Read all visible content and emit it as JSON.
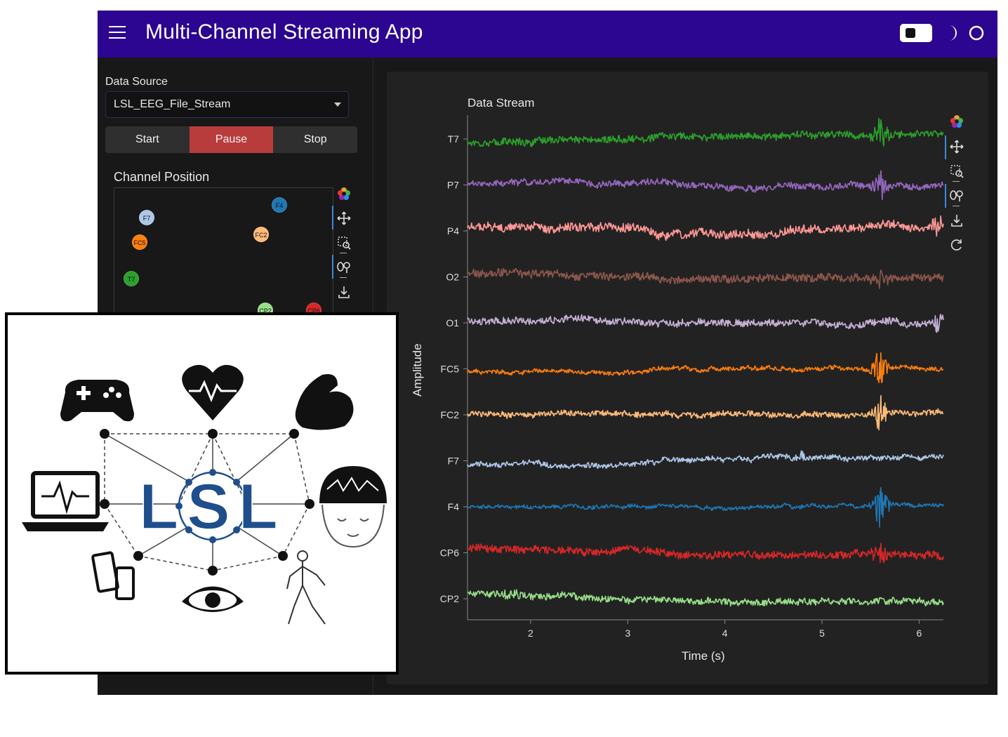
{
  "header": {
    "title": "Multi-Channel Streaming App",
    "menu_icon": "hamburger-menu-icon",
    "theme_toggle_icon": "toggle-switch-icon",
    "dark_mode_icon": "moon-icon",
    "light_mode_icon": "circle-icon",
    "bg_color": "#2c0591"
  },
  "sidebar": {
    "data_source_label": "Data Source",
    "data_source_value": "LSL_EEG_File_Stream",
    "buttons": {
      "start": "Start",
      "pause": "Pause",
      "stop": "Stop"
    },
    "active_button": "Pause",
    "channel_position": {
      "title": "Channel Position",
      "channels": [
        {
          "label": "F7",
          "color": "#aec7e8"
        },
        {
          "label": "F4",
          "color": "#1f77b4"
        },
        {
          "label": "FC2",
          "color": "#ffbb78"
        },
        {
          "label": "FC5",
          "color": "#ff7f0e"
        },
        {
          "label": "T7",
          "color": "#2ca02c"
        },
        {
          "label": "CP2",
          "color": "#98df8a"
        },
        {
          "label": "CP6",
          "color": "#d62728"
        }
      ]
    },
    "toolbar_icons": [
      "bokeh-logo-icon",
      "pan-icon",
      "box-zoom-icon",
      "wheel-zoom-icon",
      "save-icon"
    ]
  },
  "main": {
    "toolbar_icons": [
      "bokeh-logo-icon",
      "pan-icon",
      "box-zoom-icon",
      "wheel-zoom-icon",
      "save-icon",
      "reset-icon"
    ]
  },
  "chart_data": {
    "type": "line",
    "title": "Data Stream",
    "xlabel": "Time (s)",
    "ylabel": "Amplitude",
    "xlim": [
      1.35,
      6.25
    ],
    "x_ticks": [
      2,
      3,
      4,
      5,
      6
    ],
    "categories": [
      "T7",
      "P7",
      "P4",
      "O2",
      "O1",
      "FC5",
      "FC2",
      "F7",
      "F4",
      "CP6",
      "CP2"
    ],
    "grid": false,
    "series": [
      {
        "name": "T7",
        "color": "#2ca02c",
        "noise": 0.32,
        "trend": [
          [
            1.35,
            -0.3
          ],
          [
            3.0,
            -0.1
          ],
          [
            3.3,
            0.25
          ],
          [
            6.25,
            0.45
          ]
        ],
        "bursts": [
          [
            5.6,
            1.6
          ]
        ]
      },
      {
        "name": "P7",
        "color": "#9467bd",
        "noise": 0.3,
        "trend": [
          [
            1.35,
            0.2
          ],
          [
            2.5,
            0.3
          ],
          [
            3.5,
            0.1
          ],
          [
            4.2,
            -0.2
          ],
          [
            5.5,
            -0.1
          ],
          [
            6.25,
            0.1
          ]
        ],
        "bursts": [
          [
            5.6,
            1.4
          ]
        ]
      },
      {
        "name": "P4",
        "color": "#ff9896",
        "noise": 0.4,
        "trend": [
          [
            1.35,
            0.4
          ],
          [
            3.2,
            0.2
          ],
          [
            3.3,
            -0.4
          ],
          [
            4.5,
            -0.2
          ],
          [
            5.0,
            0.3
          ],
          [
            6.25,
            0.4
          ]
        ],
        "bursts": [
          [
            6.2,
            1.2
          ]
        ]
      },
      {
        "name": "O2",
        "color": "#8c564b",
        "noise": 0.35,
        "trend": [
          [
            1.35,
            0.3
          ],
          [
            3.2,
            0.2
          ],
          [
            3.3,
            -0.1
          ],
          [
            6.25,
            -0.1
          ]
        ],
        "bursts": [
          [
            5.6,
            1.0
          ]
        ]
      },
      {
        "name": "O1",
        "color": "#c5b0d5",
        "noise": 0.32,
        "trend": [
          [
            1.35,
            0.2
          ],
          [
            2.5,
            0.45
          ],
          [
            3.2,
            0.1
          ],
          [
            3.4,
            -0.1
          ],
          [
            6.25,
            0.0
          ]
        ],
        "bursts": [
          [
            6.2,
            1.0
          ]
        ]
      },
      {
        "name": "FC5",
        "color": "#ff7f0e",
        "noise": 0.18,
        "trend": [
          [
            1.35,
            -0.3
          ],
          [
            3.2,
            -0.2
          ],
          [
            3.3,
            0.05
          ],
          [
            6.25,
            0.05
          ]
        ],
        "bursts": [
          [
            5.6,
            2.0
          ]
        ]
      },
      {
        "name": "FC2",
        "color": "#ffbb78",
        "noise": 0.26,
        "trend": [
          [
            1.35,
            0.1
          ],
          [
            4.0,
            0.0
          ],
          [
            6.25,
            0.1
          ]
        ],
        "bursts": [
          [
            5.6,
            1.8
          ]
        ]
      },
      {
        "name": "F7",
        "color": "#aec7e8",
        "noise": 0.22,
        "trend": [
          [
            1.35,
            -0.5
          ],
          [
            3.0,
            -0.3
          ],
          [
            3.3,
            0.1
          ],
          [
            4.5,
            0.35
          ],
          [
            6.25,
            0.3
          ]
        ],
        "bursts": [
          [
            4.8,
            0.6
          ]
        ]
      },
      {
        "name": "F4",
        "color": "#1f77b4",
        "noise": 0.16,
        "trend": [
          [
            1.35,
            0.0
          ],
          [
            6.25,
            0.0
          ]
        ],
        "bursts": [
          [
            5.6,
            2.2
          ]
        ]
      },
      {
        "name": "CP6",
        "color": "#d62728",
        "noise": 0.34,
        "trend": [
          [
            1.35,
            0.4
          ],
          [
            3.2,
            0.2
          ],
          [
            3.4,
            -0.2
          ],
          [
            6.25,
            -0.15
          ]
        ],
        "bursts": [
          [
            5.6,
            1.1
          ]
        ]
      },
      {
        "name": "CP2",
        "color": "#98df8a",
        "noise": 0.3,
        "trend": [
          [
            1.35,
            0.5
          ],
          [
            3.2,
            0.0
          ],
          [
            4.0,
            -0.3
          ],
          [
            6.25,
            -0.3
          ]
        ],
        "bursts": [
          [
            1.8,
            0.6
          ]
        ]
      }
    ]
  },
  "logo": {
    "text": "LSL",
    "text_color": "#1f4e8c",
    "icons": [
      "gamepad-icon",
      "heart-rate-icon",
      "muscle-icon",
      "laptop-ecg-icon",
      "eeg-head-icon",
      "phone-tablet-icon",
      "eye-icon",
      "skeleton-icon"
    ]
  }
}
